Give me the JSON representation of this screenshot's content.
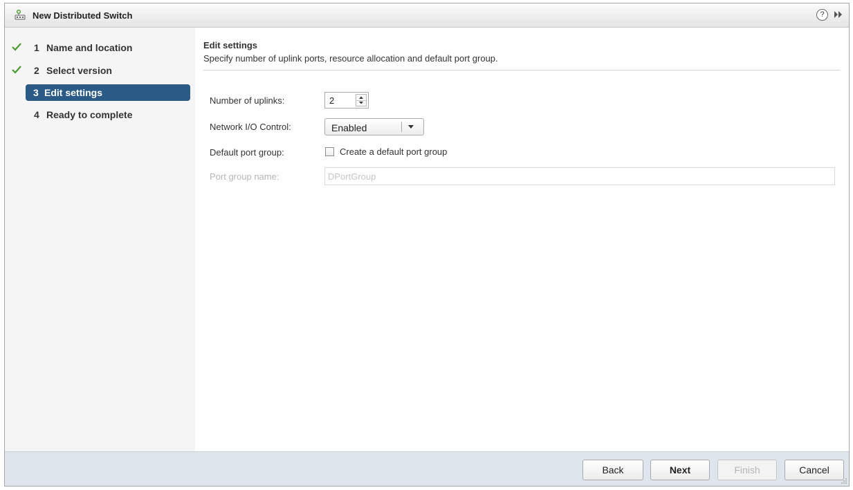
{
  "window": {
    "title": "New Distributed Switch",
    "icon": "distributed-switch-icon",
    "help_glyph": "?",
    "help_icon": "help-circle-icon",
    "expand_icon": "double-chevron-right-icon"
  },
  "steps": [
    {
      "number": "1",
      "label": "Name and location",
      "status": "completed"
    },
    {
      "number": "2",
      "label": "Select version",
      "status": "completed"
    },
    {
      "number": "3",
      "label": "Edit settings",
      "status": "active"
    },
    {
      "number": "4",
      "label": "Ready to complete",
      "status": "pending"
    }
  ],
  "content": {
    "title": "Edit settings",
    "description": "Specify number of uplink ports, resource allocation and default port group.",
    "fields": {
      "uplinks": {
        "label": "Number of uplinks:",
        "value": "2"
      },
      "nioc": {
        "label": "Network I/O Control:",
        "value": "Enabled"
      },
      "default_port_group": {
        "label": "Default port group:",
        "checkbox_label": "Create a default port group",
        "checked": false
      },
      "port_group_name": {
        "label": "Port group name:",
        "placeholder": "DPortGroup",
        "disabled": true
      }
    }
  },
  "footer": {
    "back": "Back",
    "next": "Next",
    "finish": "Finish",
    "cancel": "Cancel"
  },
  "colors": {
    "active_step_bg": "#2b5a87",
    "check_green": "#4a9a2f",
    "footer_bg": "#dfe5ec",
    "sidebar_bg": "#f5f5f5"
  }
}
